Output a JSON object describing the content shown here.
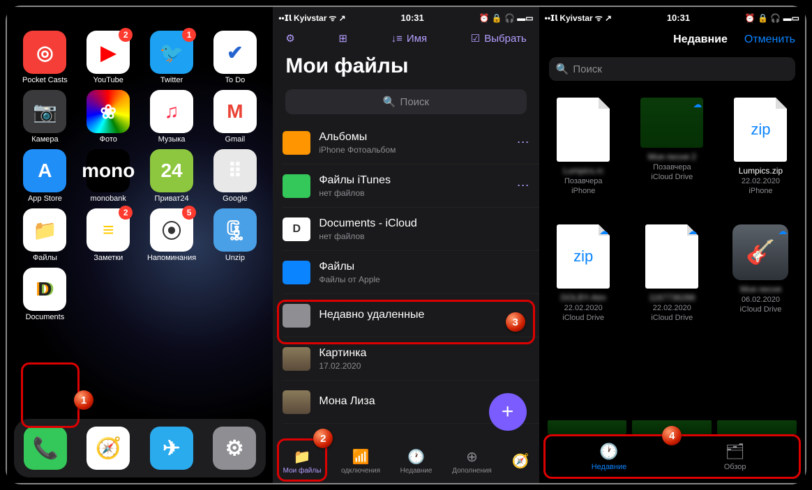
{
  "status": {
    "carrier": "Kyivstar",
    "time": "10:31"
  },
  "home": {
    "apps": [
      {
        "name": "Pocket Casts",
        "bg": "#f43e37",
        "fg": "#fff",
        "glyph": "◎"
      },
      {
        "name": "YouTube",
        "bg": "#fff",
        "fg": "#f00",
        "glyph": "▶",
        "badge": "2"
      },
      {
        "name": "Twitter",
        "bg": "#1da1f2",
        "fg": "#fff",
        "glyph": "🐦",
        "badge": "1"
      },
      {
        "name": "To Do",
        "bg": "#fff",
        "fg": "#2564cf",
        "glyph": "✔"
      },
      {
        "name": "Камера",
        "bg": "#3a3a3c",
        "fg": "#ddd",
        "glyph": "📷"
      },
      {
        "name": "Фото",
        "bg": "#fff",
        "fg": "",
        "glyph": "❀"
      },
      {
        "name": "Музыка",
        "bg": "#fff",
        "fg": "#fa2d48",
        "glyph": "♫"
      },
      {
        "name": "Gmail",
        "bg": "#fff",
        "fg": "#ea4335",
        "glyph": "M"
      },
      {
        "name": "App Store",
        "bg": "#1f8ef7",
        "fg": "#fff",
        "glyph": "A"
      },
      {
        "name": "monobank",
        "bg": "#000",
        "fg": "#fff",
        "glyph": "mono"
      },
      {
        "name": "Приват24",
        "bg": "#8dc63f",
        "fg": "#fff",
        "glyph": "24"
      },
      {
        "name": "Google",
        "bg": "#e8e8e8",
        "fg": "",
        "glyph": "⠿"
      },
      {
        "name": "Файлы",
        "bg": "#fff",
        "fg": "#1f8ef7",
        "glyph": "📁"
      },
      {
        "name": "Заметки",
        "bg": "#fff",
        "fg": "#fc0",
        "glyph": "≡",
        "badge": "2"
      },
      {
        "name": "Напоминания",
        "bg": "#fff",
        "fg": "#333",
        "glyph": "⦿",
        "badge": "5"
      },
      {
        "name": "Unzip",
        "bg": "#4aa0e6",
        "fg": "#fff",
        "glyph": "🗜"
      },
      {
        "name": "Documents",
        "bg": "#fff",
        "fg": "#333",
        "glyph": "D"
      }
    ],
    "dock": [
      {
        "name": "phone",
        "bg": "#34c759",
        "glyph": "📞"
      },
      {
        "name": "safari",
        "bg": "#fff",
        "glyph": "🧭"
      },
      {
        "name": "telegram",
        "bg": "#2aabee",
        "glyph": "✈"
      },
      {
        "name": "settings",
        "bg": "#8e8e93",
        "glyph": "⚙"
      }
    ]
  },
  "docs": {
    "toolbar": {
      "sort": "Имя",
      "select": "Выбрать"
    },
    "title": "Мои файлы",
    "search": "Поиск",
    "rows": [
      {
        "title": "Альбомы",
        "sub": "iPhone Фотоальбом",
        "icon": "#ff9500",
        "dots": true
      },
      {
        "title": "Файлы iTunes",
        "sub": "нет файлов",
        "icon": "#34c759",
        "dots": true
      },
      {
        "title": "Documents - iCloud",
        "sub": "нет файлов",
        "icon": "#fff",
        "letter": "D"
      },
      {
        "title": "Файлы",
        "sub": "Файлы от Apple",
        "icon": "#0a84ff"
      },
      {
        "title": "Недавно удаленные",
        "sub": "",
        "icon": "#8e8e93"
      },
      {
        "title": "Картинка",
        "sub": "17.02.2020"
      },
      {
        "title": "Мона Лиза",
        "sub": ""
      }
    ],
    "tabs": [
      {
        "label": "Мои файлы",
        "active": true
      },
      {
        "label": "одключения"
      },
      {
        "label": "Недавние"
      },
      {
        "label": "Дополнения"
      },
      {
        "label": ""
      }
    ]
  },
  "files": {
    "recentTitle": "Недавние",
    "cancel": "Отменить",
    "search": "Поиск",
    "items": [
      {
        "name": "Lumpics.rc",
        "meta1": "Позавчера",
        "meta2": "iPhone",
        "type": "blank",
        "blur": true
      },
      {
        "name": "Моя песня 2",
        "meta1": "Позавчера",
        "meta2": "iCloud Drive",
        "type": "green",
        "blur": true,
        "cloud": true
      },
      {
        "name": "Lumpics.zip",
        "meta1": "22.02.2020",
        "meta2": "iPhone",
        "type": "zip",
        "blur": false
      },
      {
        "name": "DOLBY-Atm",
        "meta1": "22.02.2020",
        "meta2": "iCloud Drive",
        "type": "zip",
        "blur": true,
        "cloud": true
      },
      {
        "name": "1167736288",
        "meta1": "22.02.2020",
        "meta2": "iCloud Drive",
        "type": "blank",
        "blur": true,
        "cloud": true
      },
      {
        "name": "Моя песня",
        "meta1": "06.02.2020",
        "meta2": "iCloud Drive",
        "type": "gb",
        "blur": true,
        "cloud": true
      }
    ],
    "tabs": {
      "recent": "Недавние",
      "browse": "Обзор"
    }
  },
  "markers": {
    "1": "1",
    "2": "2",
    "3": "3",
    "4": "4"
  }
}
